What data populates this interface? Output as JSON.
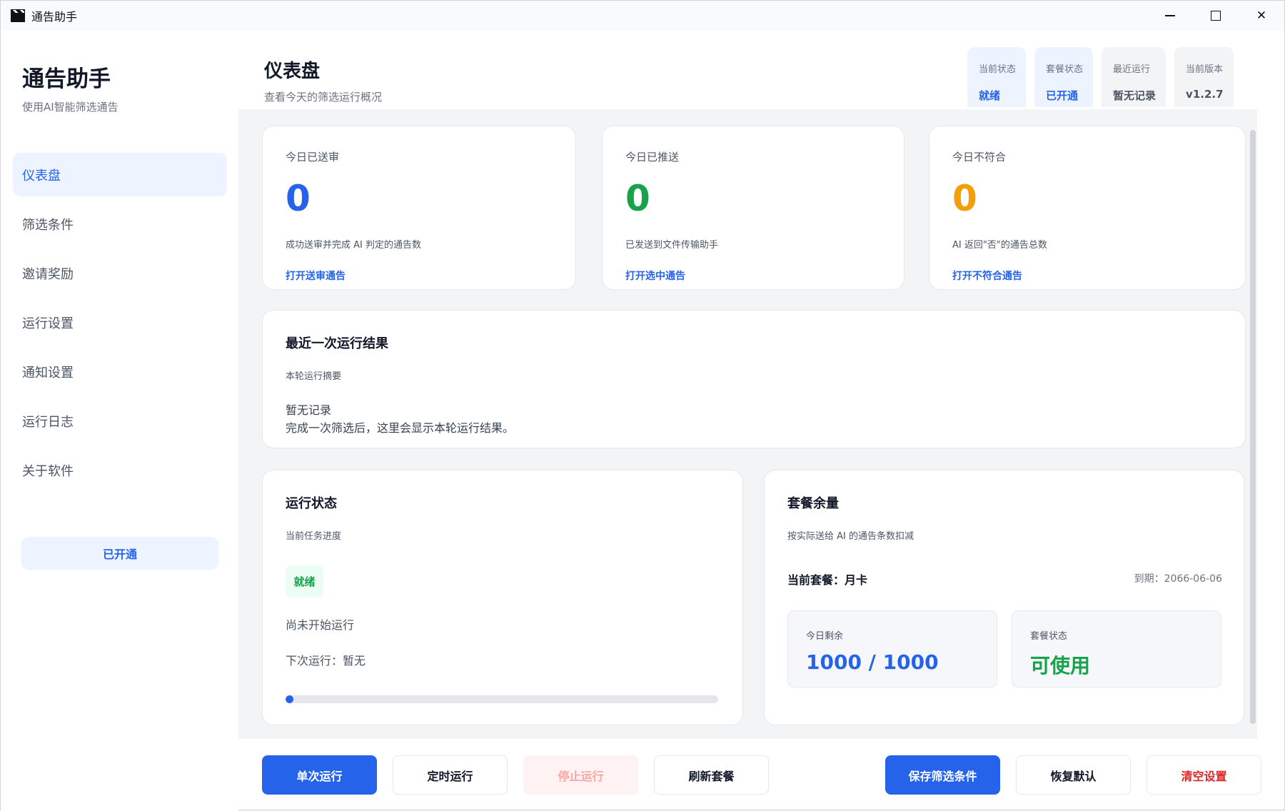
{
  "window": {
    "title": "通告助手",
    "icon": "clapperboard-icon"
  },
  "sidebar": {
    "brand_title": "通告助手",
    "brand_sub": "使用AI智能筛选通告",
    "items": [
      {
        "label": "仪表盘",
        "active": true
      },
      {
        "label": "筛选条件"
      },
      {
        "label": "邀请奖励"
      },
      {
        "label": "运行设置"
      },
      {
        "label": "通知设置"
      },
      {
        "label": "运行日志"
      },
      {
        "label": "关于软件"
      }
    ],
    "plan_label": "已开通"
  },
  "header": {
    "title": "仪表盘",
    "subtitle": "查看今天的筛选运行概况",
    "chips": [
      {
        "label": "当前状态",
        "value": "就绪"
      },
      {
        "label": "套餐状态",
        "value": "已开通"
      },
      {
        "label": "最近运行",
        "value": "暂无记录"
      },
      {
        "label": "当前版本",
        "value": "v1.2.7"
      }
    ]
  },
  "stats": [
    {
      "label": "今日已送审",
      "value": "0",
      "desc": "成功送审并完成 AI 判定的通告数",
      "link": "打开送审通告",
      "color": "#2563eb"
    },
    {
      "label": "今日已推送",
      "value": "0",
      "desc": "已发送到文件传输助手",
      "link": "打开选中通告",
      "color": "#16a34a"
    },
    {
      "label": "今日不符合",
      "value": "0",
      "desc": "AI 返回\"否\"的通告总数",
      "link": "打开不符合通告",
      "color": "#f59e0b"
    }
  ],
  "last_run": {
    "title": "最近一次运行结果",
    "subtitle": "本轮运行摘要",
    "main": "暂无记录",
    "desc": "完成一次筛选后，这里会显示本轮运行结果。"
  },
  "run_status": {
    "title": "运行状态",
    "subtitle": "当前任务进度",
    "badge": "就绪",
    "status_text": "尚未开始运行",
    "next_run": "下次运行：暂无",
    "progress": 0
  },
  "plan": {
    "title": "套餐余量",
    "subtitle": "按实际送给 AI 的通告条数扣减",
    "current": "当前套餐：月卡",
    "expiry": "到期：2066-06-06",
    "remaining_label": "今日剩余",
    "remaining_value": "1000 / 1000",
    "status_label": "套餐状态",
    "status_value": "可使用"
  },
  "footer": {
    "single_run": "单次运行",
    "scheduled_run": "定时运行",
    "stop_run": "停止运行",
    "refresh_plan": "刷新套餐",
    "save_filters": "保存筛选条件",
    "restore_default": "恢复默认",
    "clear_settings": "清空设置"
  },
  "colors": {
    "accent": "#2563eb",
    "success": "#16a34a",
    "warning": "#f59e0b",
    "danger": "#dc2626"
  }
}
